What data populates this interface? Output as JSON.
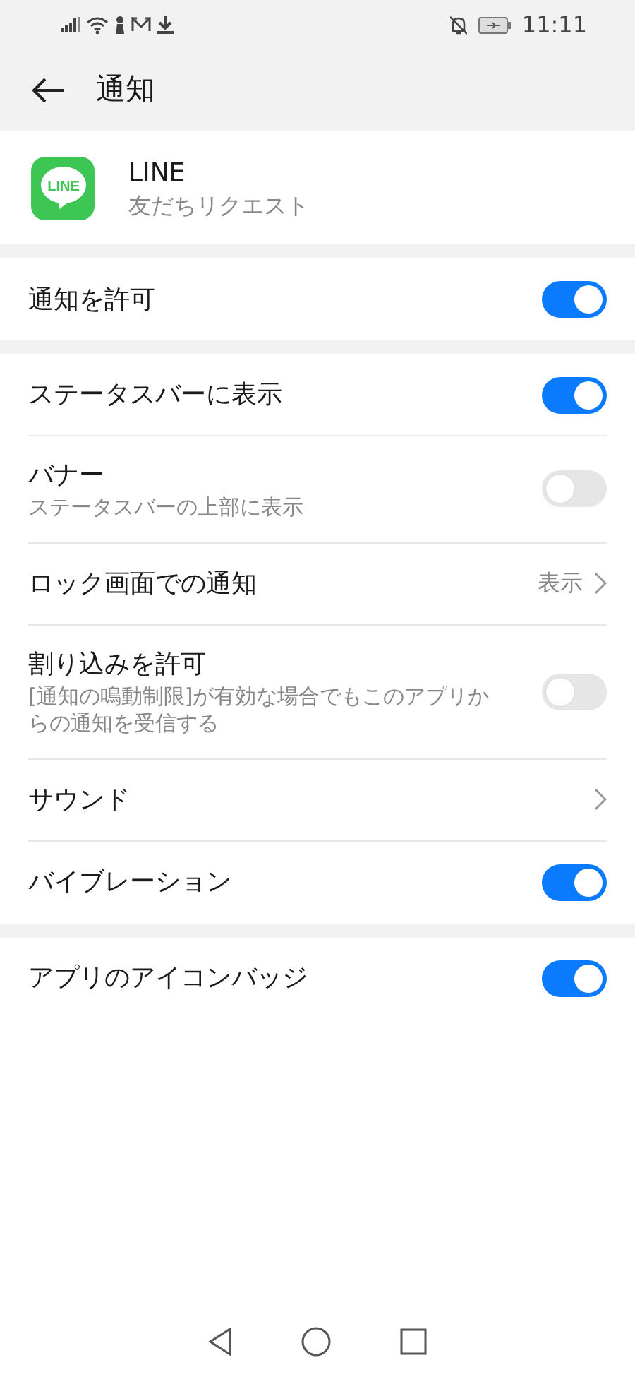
{
  "status_bar": {
    "time": "11:11"
  },
  "toolbar": {
    "title": "通知"
  },
  "app": {
    "logo_text": "LINE",
    "name": "LINE",
    "channel": "友だちリクエスト"
  },
  "groups": [
    {
      "rows": [
        {
          "kind": "toggle",
          "label": "通知を許可",
          "on": true
        }
      ]
    },
    {
      "rows": [
        {
          "kind": "toggle",
          "label": "ステータスバーに表示",
          "on": true
        },
        {
          "kind": "toggle",
          "label": "バナー",
          "sub": "ステータスバーの上部に表示",
          "on": false
        },
        {
          "kind": "link",
          "label": "ロック画面での通知",
          "value": "表示"
        },
        {
          "kind": "toggle",
          "label": "割り込みを許可",
          "sub": "[通知の鳴動制限]が有効な場合でもこのアプリからの通知を受信する",
          "on": false
        },
        {
          "kind": "link",
          "label": "サウンド"
        },
        {
          "kind": "toggle",
          "label": "バイブレーション",
          "on": true
        }
      ]
    },
    {
      "rows": [
        {
          "kind": "toggle",
          "label": "アプリのアイコンバッジ",
          "on": true
        }
      ]
    }
  ]
}
